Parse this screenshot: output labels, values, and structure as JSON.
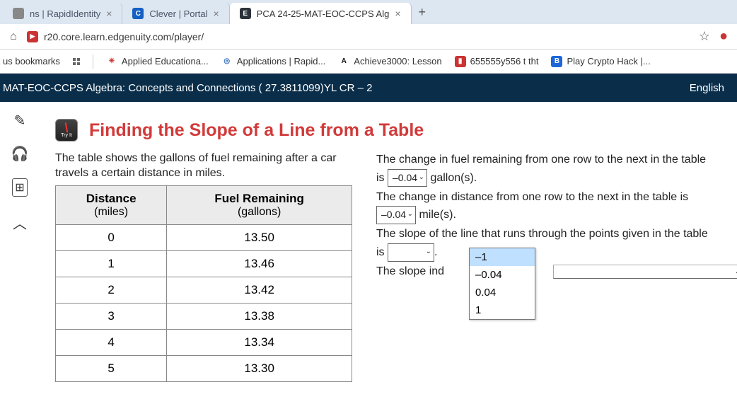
{
  "tabs": [
    {
      "label": "ns | RapidIdentity",
      "fav_bg": "#888",
      "fav_txt": ""
    },
    {
      "label": "Clever | Portal",
      "fav_bg": "#1560c2",
      "fav_txt": "C"
    },
    {
      "label": "PCA 24-25-MAT-EOC-CCPS Alg",
      "fav_bg": "#2c323a",
      "fav_txt": "E",
      "active": true
    }
  ],
  "url": "r20.core.learn.edgenuity.com/player/",
  "bookmarks_label": "us bookmarks",
  "bookmarks": [
    {
      "label": "Applied Educationa...",
      "fav_bg": "#fff",
      "fav_txt": "✳",
      "txt_color": "#c22"
    },
    {
      "label": "Applications | Rapid...",
      "fav_bg": "#fff",
      "fav_txt": "◎",
      "txt_color": "#2a6bbd"
    },
    {
      "label": "Achieve3000: Lesson",
      "fav_bg": "#fff",
      "fav_txt": "A",
      "txt_color": "#111"
    },
    {
      "label": "655555y556 t tht",
      "fav_bg": "#c33",
      "fav_txt": "▮",
      "txt_color": "#fff"
    },
    {
      "label": "Play Crypto Hack |...",
      "fav_bg": "#1c66d8",
      "fav_txt": "B",
      "txt_color": "#fff"
    }
  ],
  "course_title": "MAT-EOC-CCPS Algebra: Concepts and Connections ( 27.3811099)YL CR – 2",
  "lang": "English",
  "tryit": "Try It",
  "lesson_title": "Finding the Slope of a Line from a Table",
  "intro": "The table shows the gallons of fuel remaining after a car travels a certain distance in miles.",
  "table": {
    "h1": "Distance",
    "h1_sub": "(miles)",
    "h2": "Fuel Remaining",
    "h2_sub": "(gallons)",
    "rows": [
      {
        "d": "0",
        "f": "13.50"
      },
      {
        "d": "1",
        "f": "13.46"
      },
      {
        "d": "2",
        "f": "13.42"
      },
      {
        "d": "3",
        "f": "13.38"
      },
      {
        "d": "4",
        "f": "13.34"
      },
      {
        "d": "5",
        "f": "13.30"
      }
    ]
  },
  "q": {
    "line1a": "The change in fuel remaining from one row to the next in the table is ",
    "sel1": "–0.04",
    "line1b": " gallon(s).",
    "line2a": "The change in distance from one row to the next in the table is ",
    "sel2": "–0.04",
    "line2b": " mile(s).",
    "line3": "The slope of the line that runs through the points given in the table is ",
    "line4": "The slope ind"
  },
  "dropdown_options": [
    "–1",
    "–0.04",
    "0.04",
    "1"
  ]
}
